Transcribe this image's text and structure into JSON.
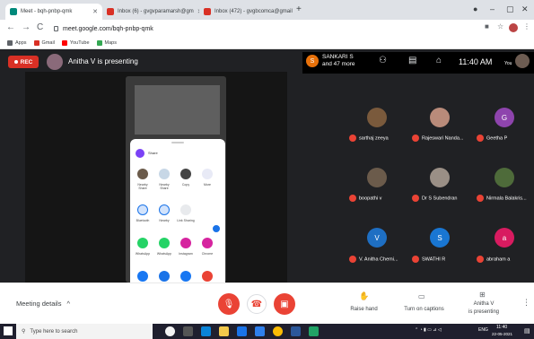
{
  "browser": {
    "tabs": [
      {
        "label": "Meet - bqh-pnbp-qmk",
        "color": "#00897b",
        "active": true
      },
      {
        "label": "Inbox (6) - gvgvparamarsh@gm",
        "color": "#d93025",
        "active": false
      },
      {
        "label": "Inbox (472) - gvgbcomca@gmail",
        "color": "#d93025",
        "active": false
      }
    ],
    "new_tab": "+",
    "url": "meet.google.com/bqh-pnbp-qmk",
    "bookmarks": [
      "Apps",
      "Gmail",
      "YouTube",
      "Maps"
    ]
  },
  "meet": {
    "rec_label": "REC",
    "presenting_text": "Anitha V is presenting",
    "others_name": "SANKARI S",
    "others_count": "and 47 more",
    "others_initial": "S",
    "time": "11:40 AM",
    "you_label": "You"
  },
  "share_sheet": {
    "title": "Share",
    "row1": [
      "Nearby Share",
      "Nearby Share",
      "Copy",
      "More"
    ],
    "row2": [
      "Bluetooth",
      "Nearby",
      "Link Sharing"
    ],
    "row3": [
      "WhatsApp",
      "WhatsApp",
      "Instagram",
      "Chrome"
    ]
  },
  "participants": [
    {
      "name": "sarthaj zeeya",
      "initial": "",
      "color": "#7a5a3c"
    },
    {
      "name": "Rajeswari Nanda...",
      "initial": "",
      "color": "#b98b7a"
    },
    {
      "name": "Geetha P",
      "initial": "G",
      "color": "#8e44ad"
    },
    {
      "name": "boopathi v",
      "initial": "",
      "color": "#6b5b4b"
    },
    {
      "name": "Dr S Subendran",
      "initial": "",
      "color": "#9a8f86"
    },
    {
      "name": "Nirmala Balakris...",
      "initial": "",
      "color": "#4e6b3a"
    },
    {
      "name": "V. Anitha Chemi...",
      "initial": "V",
      "color": "#1e6fc3"
    },
    {
      "name": "SWATHI R",
      "initial": "S",
      "color": "#1976d2"
    },
    {
      "name": "abraham a",
      "initial": "a",
      "color": "#d81b60"
    }
  ],
  "controls": {
    "meeting_details": "Meeting details",
    "raise_hand": "Raise hand",
    "captions": "Turn on captions",
    "presenter": "Anitha V",
    "presenting": "is presenting"
  },
  "taskbar": {
    "search_placeholder": "Type here to search",
    "time": "11:40",
    "date": "22-05-2021",
    "lang": "ENG"
  }
}
